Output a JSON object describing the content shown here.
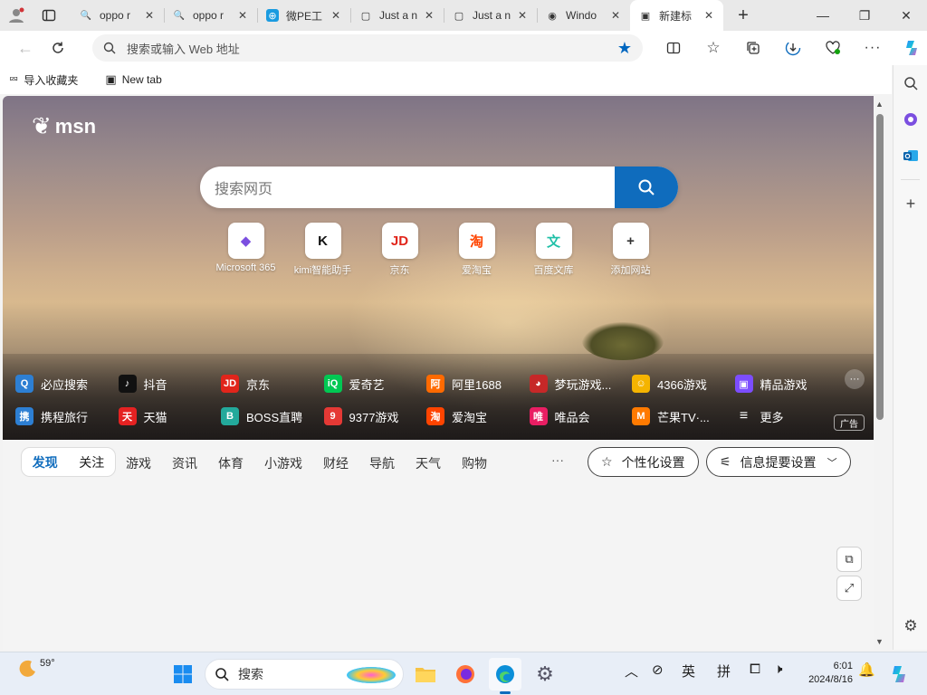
{
  "tabs": [
    {
      "title": "oppo r",
      "icon": "search-icon",
      "active": false
    },
    {
      "title": "oppo r",
      "icon": "search-icon",
      "active": false
    },
    {
      "title": "微PE工",
      "icon": "wepe-icon",
      "active": false
    },
    {
      "title": "Just a n",
      "icon": "page-icon",
      "active": false
    },
    {
      "title": "Just a n",
      "icon": "page-icon",
      "active": false
    },
    {
      "title": "Windo",
      "icon": "windows-site-icon",
      "active": false
    },
    {
      "title": "新建标",
      "icon": "newtab-page-icon",
      "active": true
    }
  ],
  "address_bar": {
    "placeholder": "搜索或输入 Web 地址"
  },
  "favorites": [
    {
      "label": "导入收藏夹",
      "icon": "import-favorites-icon"
    },
    {
      "label": "New tab",
      "icon": "newtab-page-icon"
    }
  ],
  "msn": {
    "logo": "msn",
    "search_placeholder": "搜索网页",
    "quick_links": [
      {
        "label": "Microsoft 365",
        "glyph": "◆",
        "color": "#7b4fe0"
      },
      {
        "label": "kimi智能助手",
        "glyph": "K",
        "color": "#111111"
      },
      {
        "label": "京东",
        "glyph": "JD",
        "color": "#e1251b"
      },
      {
        "label": "爱淘宝",
        "glyph": "淘",
        "color": "#ff4400"
      },
      {
        "label": "百度文库",
        "glyph": "文",
        "color": "#21c0a8"
      },
      {
        "label": "添加网站",
        "glyph": "+",
        "color": "#333333"
      }
    ],
    "sites_row1": [
      {
        "label": "必应搜索",
        "glyph": "Q",
        "color": "#2d7fd3"
      },
      {
        "label": "抖音",
        "glyph": "♪",
        "color": "#111111"
      },
      {
        "label": "京东",
        "glyph": "JD",
        "color": "#e1251b"
      },
      {
        "label": "爱奇艺",
        "glyph": "iQ",
        "color": "#00c853"
      },
      {
        "label": "阿里1688",
        "glyph": "阿",
        "color": "#ff6a00"
      },
      {
        "label": "梦玩游戏...",
        "glyph": "◕",
        "color": "#c62828"
      },
      {
        "label": "4366游戏",
        "glyph": "☺",
        "color": "#f5b400"
      },
      {
        "label": "精品游戏",
        "glyph": "▣",
        "color": "#7c4dff"
      }
    ],
    "sites_row2": [
      {
        "label": "携程旅行",
        "glyph": "携",
        "color": "#2d7fd3"
      },
      {
        "label": "天猫",
        "glyph": "天",
        "color": "#e52222"
      },
      {
        "label": "BOSS直聘",
        "glyph": "B",
        "color": "#23a99b"
      },
      {
        "label": "9377游戏",
        "glyph": "9",
        "color": "#e53935"
      },
      {
        "label": "爱淘宝",
        "glyph": "淘",
        "color": "#ff4400"
      },
      {
        "label": "唯品会",
        "glyph": "唯",
        "color": "#e91e63"
      },
      {
        "label": "芒果TV·...",
        "glyph": "M",
        "color": "#ff7a00"
      },
      {
        "label": "更多",
        "glyph": "≡",
        "color": "transparent"
      }
    ],
    "ad_label": "广告"
  },
  "feed": {
    "pill": [
      "发现",
      "关注"
    ],
    "tabs": [
      "游戏",
      "资讯",
      "体育",
      "小游戏",
      "财经",
      "导航",
      "天气",
      "购物"
    ],
    "more": "···",
    "personalize": "个性化设置",
    "info_settings": "信息提要设置"
  },
  "taskbar": {
    "weather_temp": "59°",
    "search_placeholder": "搜索",
    "ime_lang": "英",
    "ime_mode": "拼",
    "time": "6:01",
    "date": "2024/8/16"
  },
  "colors": {
    "accent": "#0f6cbd",
    "tabstrip_bg": "#e9e9e9"
  }
}
